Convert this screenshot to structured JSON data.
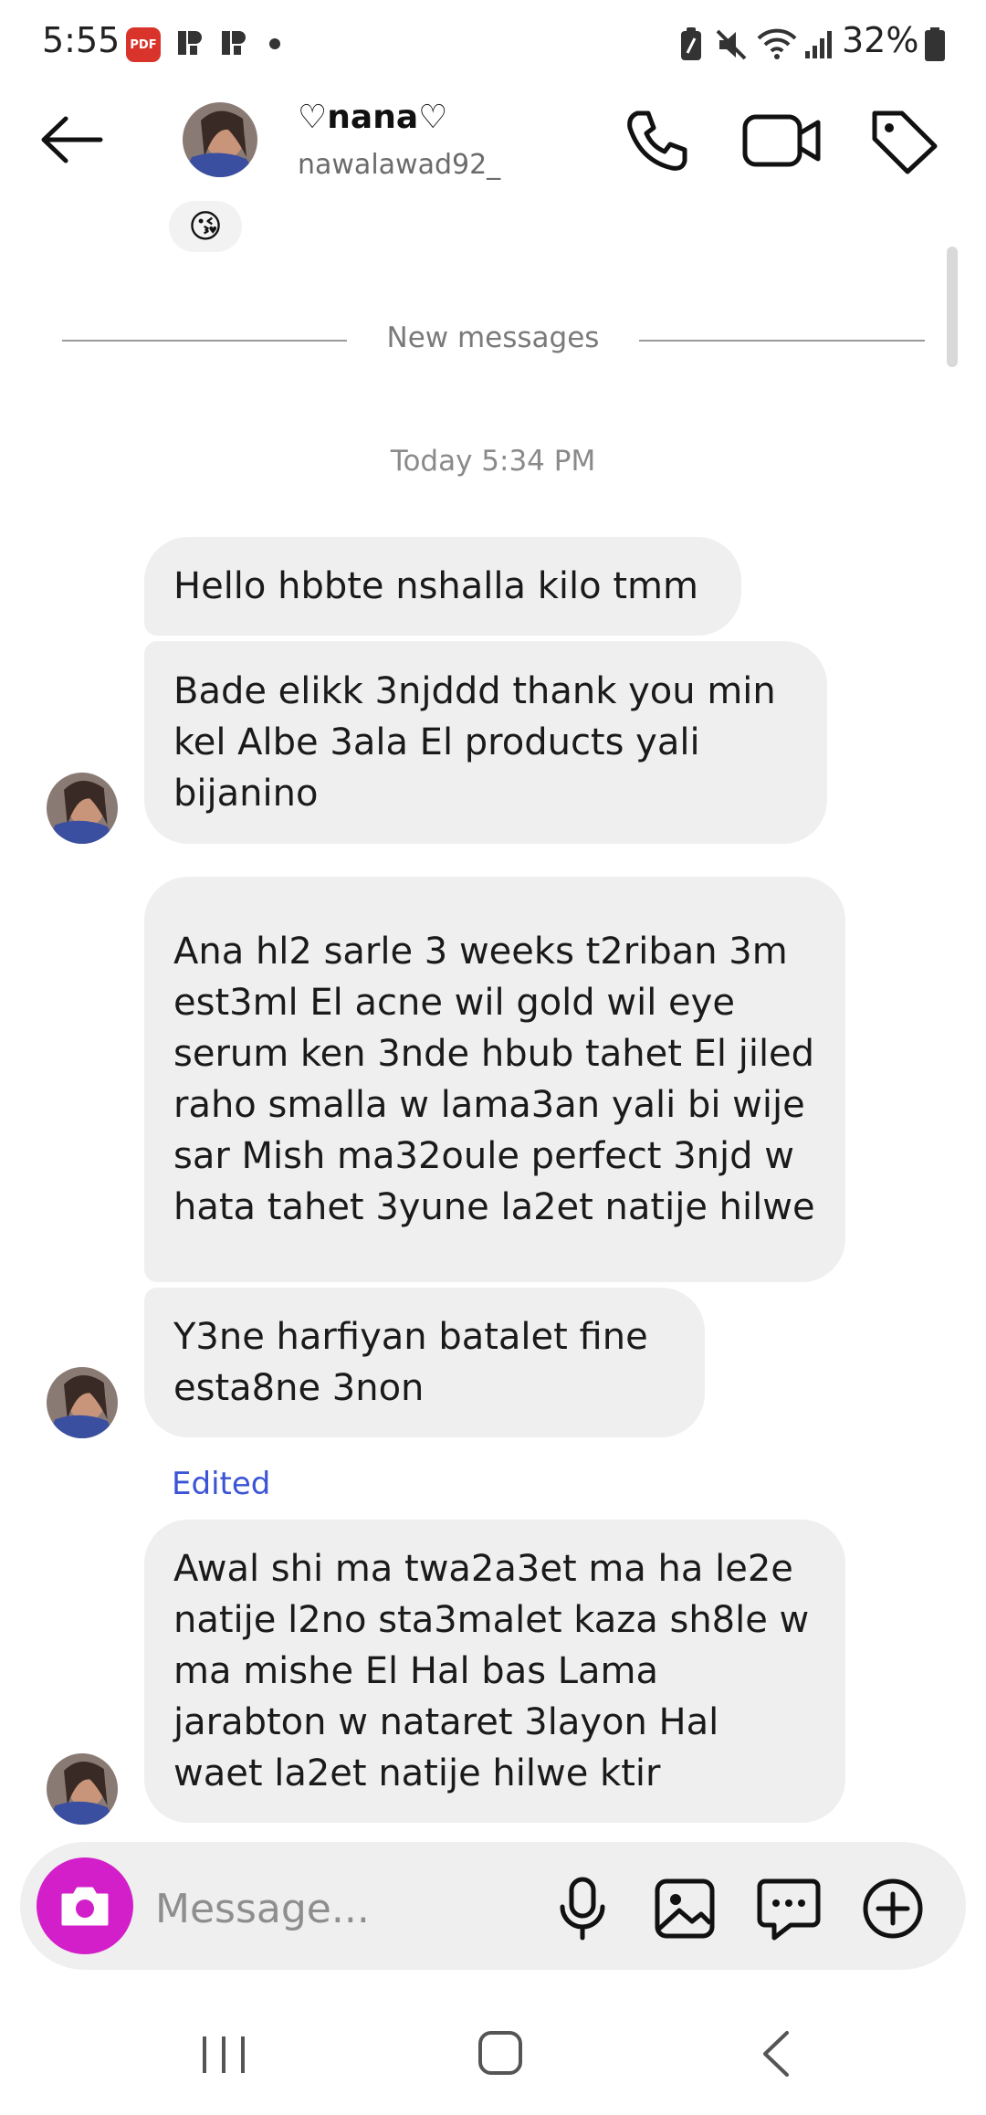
{
  "status_bar": {
    "time": "5:55",
    "notification_icons": [
      "pdf-icon",
      "app-r-icon",
      "app-r-icon",
      "dot-icon"
    ],
    "pdf_label": "PDF",
    "battery_percent": "32%",
    "system_icons": [
      "nfc-icon",
      "mute-icon",
      "wifi-icon",
      "signal-icon",
      "battery-icon"
    ]
  },
  "header": {
    "display_name": "♡nana♡",
    "username": "nawalawad92_",
    "actions": [
      "phone-icon",
      "video-camera-icon",
      "tag-icon"
    ]
  },
  "conversation": {
    "reaction_emoji": "😘",
    "new_messages_label": "New messages",
    "timestamp": "Today 5:34 PM",
    "messages": [
      {
        "text": "Hello hbbte nshalla kilo tmm"
      },
      {
        "text": "Bade elikk 3njddd thank you min kel Albe 3ala El products yali bijanino"
      },
      {
        "text": "Ana hl2 sarle 3 weeks t2riban 3m est3ml El acne wil gold wil eye serum ken 3nde hbub tahet El jiled raho smalla w lama3an yali bi wije sar Mish ma32oule perfect 3njd w hata tahet 3yune la2et natije hilwe"
      },
      {
        "text": "Y3ne harfiyan batalet fine esta8ne 3non"
      },
      {
        "text": "Awal shi ma twa2a3et ma ha le2e natije l2no sta3malet kaza sh8le w ma mishe El Hal bas Lama jarabton w nataret 3layon Hal waet la2et natije hilwe ktir",
        "edited": true
      }
    ],
    "edited_label": "Edited"
  },
  "composer": {
    "placeholder": "Message...",
    "value": "",
    "actions": [
      "microphone-icon",
      "gallery-icon",
      "sticker-icon",
      "plus-icon"
    ]
  },
  "colors": {
    "accent_camera": "#d31fc9",
    "bubble_bg": "#efefef",
    "edited_blue": "#3b54d4"
  }
}
